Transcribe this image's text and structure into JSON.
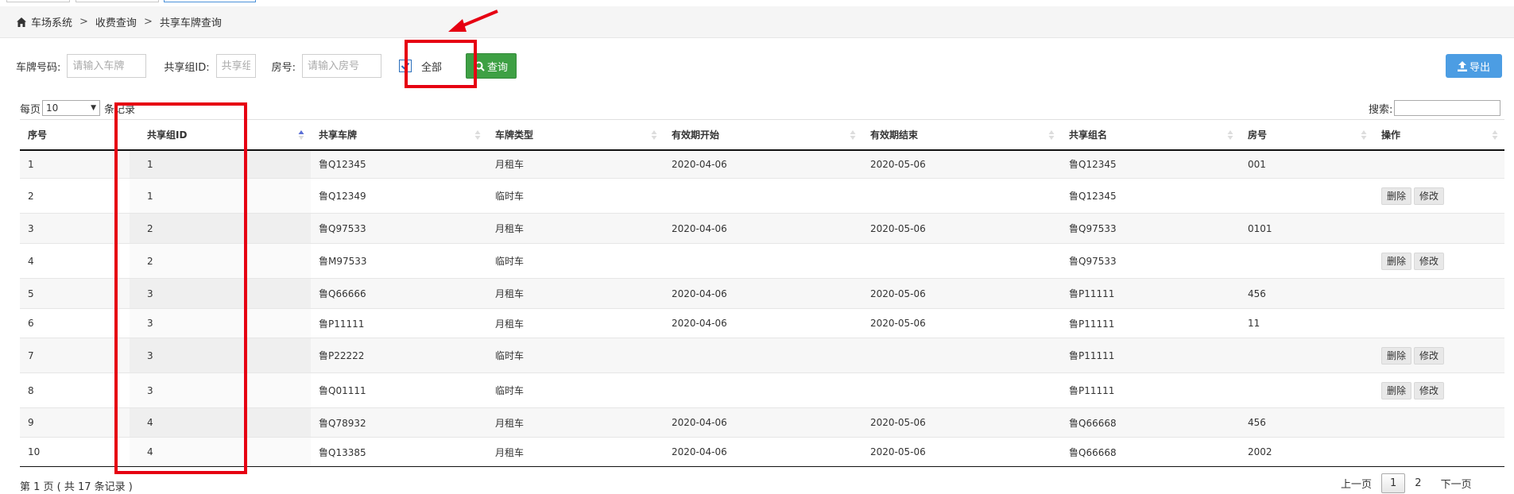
{
  "breadcrumb": {
    "items": [
      "车场系统",
      "收费查询",
      "共享车牌查询"
    ],
    "separator": ">"
  },
  "filters": {
    "plate_label": "车牌号码:",
    "plate_placeholder": "请输入车牌",
    "group_label": "共享组ID:",
    "group_placeholder": "共享组",
    "room_label": "房号:",
    "room_placeholder": "请输入房号",
    "all_label": "全部",
    "all_checked": true,
    "query_label": "查询",
    "export_label": "导出"
  },
  "table_controls": {
    "per_page_prefix": "每页",
    "per_page_value": "10",
    "per_page_suffix": "条记录",
    "search_label": "搜索:"
  },
  "columns": [
    "序号",
    "共享组ID",
    "共享车牌",
    "车牌类型",
    "有效期开始",
    "有效期结束",
    "共享组名",
    "房号",
    "操作"
  ],
  "rows": [
    {
      "no": "1",
      "group_id": "1",
      "plate": "鲁Q12345",
      "type": "月租车",
      "start": "2020-04-06",
      "end": "2020-05-06",
      "group_name": "鲁Q12345",
      "room": "001",
      "actions": []
    },
    {
      "no": "2",
      "group_id": "1",
      "plate": "鲁Q12349",
      "type": "临时车",
      "start": "",
      "end": "",
      "group_name": "鲁Q12345",
      "room": "",
      "actions": [
        "删除",
        "修改"
      ]
    },
    {
      "no": "3",
      "group_id": "2",
      "plate": "鲁Q97533",
      "type": "月租车",
      "start": "2020-04-06",
      "end": "2020-05-06",
      "group_name": "鲁Q97533",
      "room": "0101",
      "actions": []
    },
    {
      "no": "4",
      "group_id": "2",
      "plate": "鲁M97533",
      "type": "临时车",
      "start": "",
      "end": "",
      "group_name": "鲁Q97533",
      "room": "",
      "actions": [
        "删除",
        "修改"
      ]
    },
    {
      "no": "5",
      "group_id": "3",
      "plate": "鲁Q66666",
      "type": "月租车",
      "start": "2020-04-06",
      "end": "2020-05-06",
      "group_name": "鲁P11111",
      "room": "456",
      "actions": []
    },
    {
      "no": "6",
      "group_id": "3",
      "plate": "鲁P11111",
      "type": "月租车",
      "start": "2020-04-06",
      "end": "2020-05-06",
      "group_name": "鲁P11111",
      "room": "11",
      "actions": []
    },
    {
      "no": "7",
      "group_id": "3",
      "plate": "鲁P22222",
      "type": "临时车",
      "start": "",
      "end": "",
      "group_name": "鲁P11111",
      "room": "",
      "actions": [
        "删除",
        "修改"
      ]
    },
    {
      "no": "8",
      "group_id": "3",
      "plate": "鲁Q01111",
      "type": "临时车",
      "start": "",
      "end": "",
      "group_name": "鲁P11111",
      "room": "",
      "actions": [
        "删除",
        "修改"
      ]
    },
    {
      "no": "9",
      "group_id": "4",
      "plate": "鲁Q78932",
      "type": "月租车",
      "start": "2020-04-06",
      "end": "2020-05-06",
      "group_name": "鲁Q66668",
      "room": "456",
      "actions": []
    },
    {
      "no": "10",
      "group_id": "4",
      "plate": "鲁Q13385",
      "type": "月租车",
      "start": "2020-04-06",
      "end": "2020-05-06",
      "group_name": "鲁Q66668",
      "room": "2002",
      "actions": []
    }
  ],
  "footer": {
    "info": "第 1 页 ( 共 17 条记录 )",
    "prev": "上一页",
    "pages": [
      "1",
      "2"
    ],
    "current": "1",
    "next": "下一页"
  },
  "colors": {
    "annotation": "#e60012",
    "query_button": "#3ea044",
    "export_button": "#4c9de3"
  }
}
